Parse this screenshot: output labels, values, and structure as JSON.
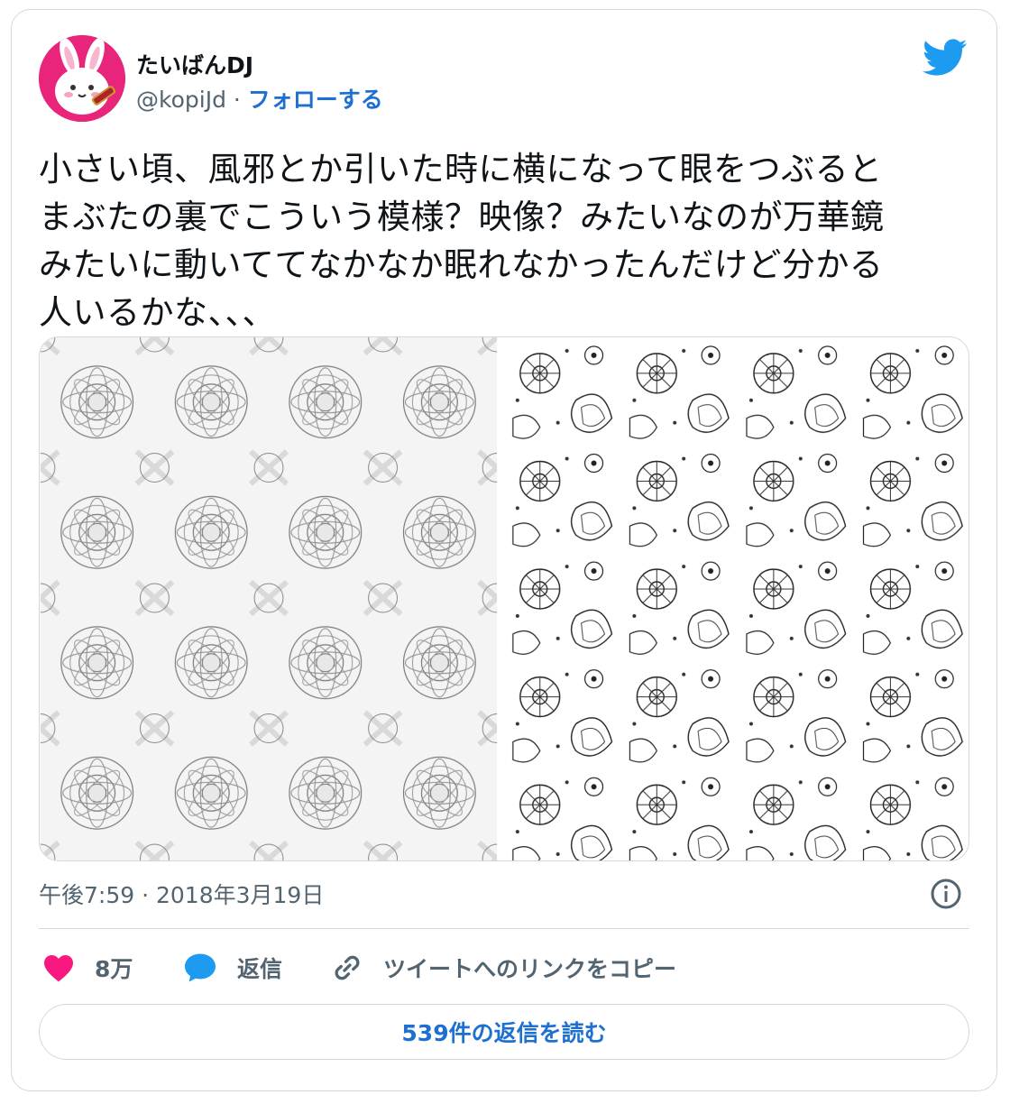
{
  "user": {
    "display_name": "たいばんDJ",
    "handle": "@kopiJd",
    "separator": " · ",
    "follow_label": "フォローする"
  },
  "tweet": {
    "lines": [
      "小さい頃、風邪とか引いた時に横になって眼をつぶると",
      "まぶたの裏でこういう模様？映像？みたいなのが万華鏡",
      "みたいに動いててなかなか眠れなかったんだけど分かる",
      "人いるかな、、、"
    ],
    "timestamp": "午後7:59 · 2018年3月19日"
  },
  "actions": {
    "like_count": "8万",
    "reply_label": "返信",
    "copy_link_label": "ツイートへのリンクをコピー"
  },
  "read_replies_label": "539件の返信を読む",
  "colors": {
    "twitter_blue": "#1d9bf0",
    "link_blue": "#1d6fd1",
    "heart": "#f91880",
    "avatar_bg": "#e8257a",
    "muted": "#536471",
    "border": "#cfd9de"
  },
  "icons": {
    "brand": "twitter-bird-icon",
    "info": "info-icon",
    "like": "heart-icon",
    "reply": "speech-bubble-icon",
    "copy": "link-icon"
  }
}
